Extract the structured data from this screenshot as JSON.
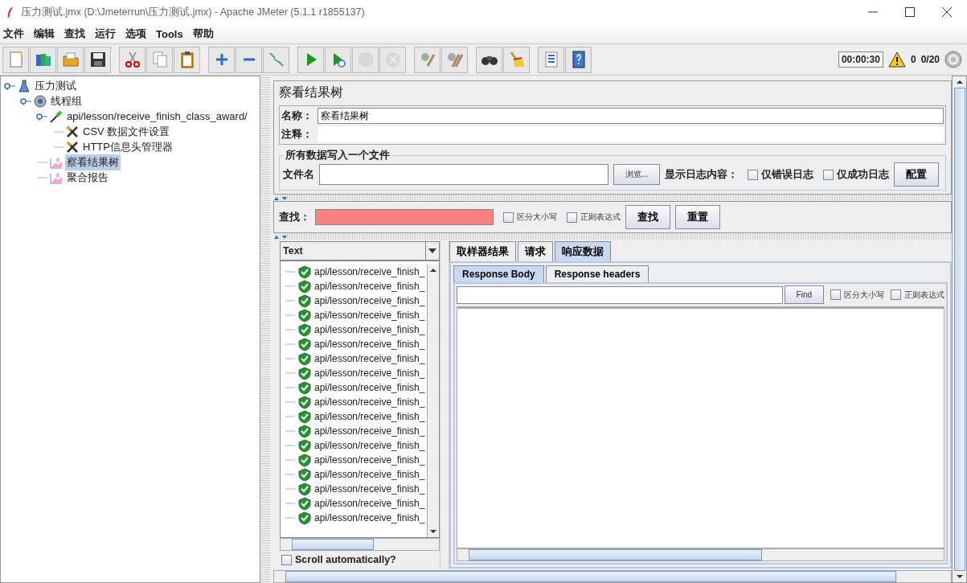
{
  "window": {
    "title": "压力测试.jmx (D:\\Jmeterrun\\压力测试.jmx) - Apache JMeter (5.1.1 r1855137)"
  },
  "menu": [
    "文件",
    "编辑",
    "查找",
    "运行",
    "选项",
    "Tools",
    "帮助"
  ],
  "toolbar": [
    {
      "kind": "new",
      "disabled": false
    },
    {
      "kind": "templates",
      "disabled": false
    },
    {
      "kind": "open",
      "disabled": false
    },
    {
      "kind": "save",
      "disabled": false
    },
    {
      "kind": "separator"
    },
    {
      "kind": "cut",
      "disabled": false
    },
    {
      "kind": "copy",
      "disabled": false
    },
    {
      "kind": "paste",
      "disabled": false
    },
    {
      "kind": "separator"
    },
    {
      "kind": "expand",
      "disabled": false
    },
    {
      "kind": "collapse",
      "disabled": false
    },
    {
      "kind": "toggle",
      "disabled": false
    },
    {
      "kind": "separator"
    },
    {
      "kind": "start",
      "disabled": false
    },
    {
      "kind": "start-no-pause",
      "disabled": false
    },
    {
      "kind": "stop",
      "disabled": true
    },
    {
      "kind": "shutdown",
      "disabled": true
    },
    {
      "kind": "separator"
    },
    {
      "kind": "clear",
      "disabled": false
    },
    {
      "kind": "clear-all",
      "disabled": false
    },
    {
      "kind": "separator"
    },
    {
      "kind": "search",
      "disabled": false
    },
    {
      "kind": "reset-search",
      "disabled": false
    },
    {
      "kind": "separator"
    },
    {
      "kind": "functions",
      "disabled": false
    },
    {
      "kind": "help",
      "disabled": false
    }
  ],
  "status": {
    "timer": "00:00:30",
    "warnings": "0",
    "threads": "0/20"
  },
  "tree": [
    {
      "label": "压力测试",
      "kind": "testplan",
      "selected": false,
      "children": [
        {
          "label": "线程组",
          "kind": "threadgroup",
          "selected": false,
          "children": [
            {
              "label": "api/lesson/receive_finish_class_award/",
              "kind": "sampler",
              "selected": false,
              "children": [
                {
                  "label": "CSV 数据文件设置",
                  "kind": "config",
                  "selected": false
                },
                {
                  "label": "HTTP信息头管理器",
                  "kind": "config",
                  "selected": false
                }
              ]
            },
            {
              "label": "察看结果树",
              "kind": "listener",
              "selected": true
            },
            {
              "label": "聚合报告",
              "kind": "listener",
              "selected": false
            }
          ]
        }
      ]
    }
  ],
  "editor": {
    "title": "察看结果树",
    "name_label": "名称：",
    "name_value": "察看结果树",
    "comment_label": "注释：",
    "file_group": "所有数据写入一个文件",
    "file_label": "文件名",
    "browse": "浏览...",
    "log_label": "显示日志内容：",
    "log_options": [
      {
        "label": "仅错误日志",
        "checked": false
      },
      {
        "label": "仅成功日志",
        "checked": false
      }
    ],
    "config": "配置"
  },
  "search": {
    "label": "查找：",
    "options": [
      {
        "label": "区分大小写",
        "checked": false
      },
      {
        "label": "正则表达式",
        "checked": false
      }
    ],
    "find": "查找",
    "reset": "重置"
  },
  "results": {
    "renderer": "Text",
    "rows": [
      {
        "label": "api/lesson/receive_finish_"
      },
      {
        "label": "api/lesson/receive_finish_"
      },
      {
        "label": "api/lesson/receive_finish_"
      },
      {
        "label": "api/lesson/receive_finish_"
      },
      {
        "label": "api/lesson/receive_finish_"
      },
      {
        "label": "api/lesson/receive_finish_"
      },
      {
        "label": "api/lesson/receive_finish_"
      },
      {
        "label": "api/lesson/receive_finish_"
      },
      {
        "label": "api/lesson/receive_finish_"
      },
      {
        "label": "api/lesson/receive_finish_"
      },
      {
        "label": "api/lesson/receive_finish_"
      },
      {
        "label": "api/lesson/receive_finish_"
      },
      {
        "label": "api/lesson/receive_finish_"
      },
      {
        "label": "api/lesson/receive_finish_"
      },
      {
        "label": "api/lesson/receive_finish_"
      },
      {
        "label": "api/lesson/receive_finish_"
      },
      {
        "label": "api/lesson/receive_finish_"
      },
      {
        "label": "api/lesson/receive_finish_"
      }
    ],
    "scroll_auto": {
      "label": "Scroll automatically?",
      "checked": false
    }
  },
  "tabs": [
    {
      "label": "取样器结果",
      "selected": false
    },
    {
      "label": "请求",
      "selected": false
    },
    {
      "label": "响应数据",
      "selected": true
    }
  ],
  "subtabs": [
    {
      "label": "Response Body",
      "selected": true
    },
    {
      "label": "Response headers",
      "selected": false
    }
  ],
  "response": {
    "find": "Find",
    "options": [
      {
        "label": "区分大小写",
        "checked": false
      },
      {
        "label": "正则表达式",
        "checked": false
      }
    ]
  }
}
